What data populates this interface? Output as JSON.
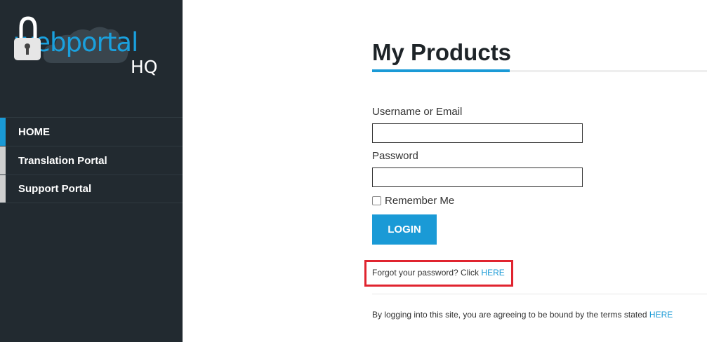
{
  "brand": {
    "logo_text": "webportal",
    "logo_sub": "HQ"
  },
  "sidebar": {
    "items": [
      {
        "label": "HOME",
        "active": true
      },
      {
        "label": "Translation Portal",
        "active": false
      },
      {
        "label": "Support Portal",
        "active": false
      }
    ]
  },
  "main": {
    "title": "My Products",
    "username_label": "Username or Email",
    "username_value": "",
    "password_label": "Password",
    "password_value": "",
    "remember_label": "Remember Me",
    "remember_checked": false,
    "login_button": "LOGIN",
    "forgot_text": "Forgot your password? Click",
    "forgot_link": "HERE",
    "terms_text": "By logging into this site, you are agreeing to be bound by the terms stated",
    "terms_link": "HERE"
  },
  "colors": {
    "sidebar_bg": "#222a30",
    "accent": "#1a9ad6",
    "highlight_box": "#e0242f"
  }
}
